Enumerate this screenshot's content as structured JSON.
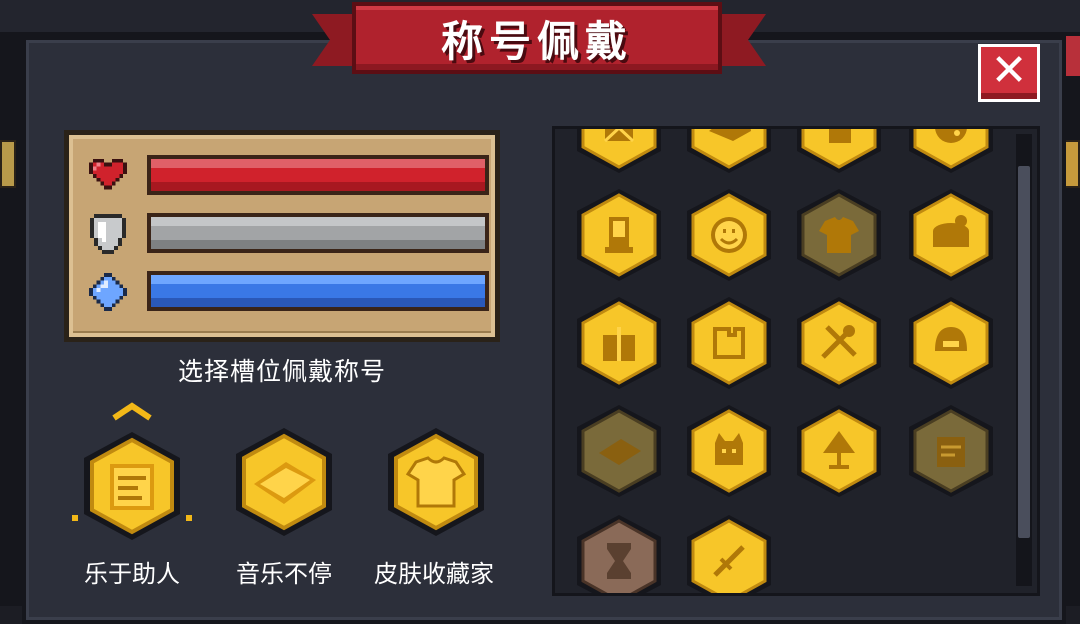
{
  "title": "称号佩戴",
  "slot_label": "选择槽位佩戴称号",
  "stats": [
    {
      "name": "hp",
      "icon": "heart-icon",
      "fill": 1.0,
      "color": "#d0222c"
    },
    {
      "name": "armor",
      "icon": "shield-icon",
      "fill": 1.0,
      "color": "#a2a4a6"
    },
    {
      "name": "mana",
      "icon": "crystal-icon",
      "fill": 1.0,
      "color": "#3a78e6"
    }
  ],
  "equipped": [
    {
      "label": "乐于助人",
      "icon": "scroll-icon",
      "selected": true
    },
    {
      "label": "音乐不停",
      "icon": "music-box-icon",
      "selected": false
    },
    {
      "label": "皮肤收藏家",
      "icon": "shirt-icon",
      "selected": false
    }
  ],
  "grid_badges": [
    {
      "icon": "crate-icon",
      "owned": true
    },
    {
      "icon": "handshake-icon",
      "owned": true
    },
    {
      "icon": "thumbs-up-icon",
      "owned": true
    },
    {
      "icon": "moon-icon",
      "owned": true
    },
    {
      "icon": "phone-icon",
      "owned": true
    },
    {
      "icon": "smiley-icon",
      "owned": true
    },
    {
      "icon": "shirt-icon",
      "owned": false
    },
    {
      "icon": "drum-icon",
      "owned": true
    },
    {
      "icon": "gift-icon",
      "owned": true
    },
    {
      "icon": "puzzle-icon",
      "owned": true
    },
    {
      "icon": "tools-icon",
      "owned": true
    },
    {
      "icon": "helmet-icon",
      "owned": true
    },
    {
      "icon": "music-box-icon",
      "owned": false
    },
    {
      "icon": "cat-icon",
      "owned": true
    },
    {
      "icon": "lamp-icon",
      "owned": true
    },
    {
      "icon": "scroll-icon",
      "owned": false
    },
    {
      "icon": "hourglass-icon",
      "owned": false
    },
    {
      "icon": "sword-icon",
      "owned": true
    }
  ],
  "colors": {
    "gold": "#f2b818",
    "gold_dark": "#a87810",
    "ribbon": "#b0222d",
    "panel": "#2c2f3a"
  }
}
